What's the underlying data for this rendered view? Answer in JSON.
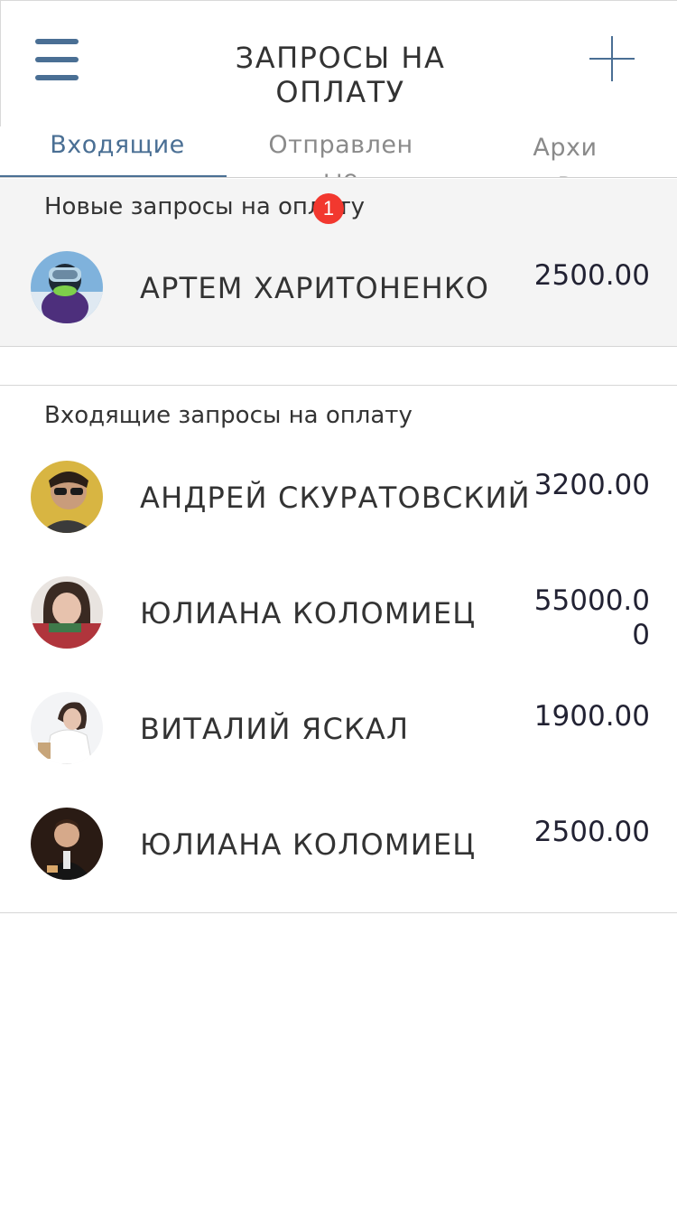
{
  "header": {
    "title": "ЗАПРОСЫ НА ОПЛАТУ",
    "menu_icon": "hamburger-menu-icon",
    "add_icon": "plus-icon"
  },
  "tabs": [
    {
      "label": "Входящие",
      "active": true
    },
    {
      "label": "Отправленые",
      "active": false
    },
    {
      "label": "Архив",
      "active": false
    }
  ],
  "new_requests": {
    "title": "Новые запросы на оплату",
    "badge_count": "1",
    "items": [
      {
        "name": "АРТЕМ ХАРИТОНЕНКО",
        "amount": "2500.00",
        "avatar": "avatar-photo"
      }
    ]
  },
  "incoming_requests": {
    "title": "Входящие запросы на оплату",
    "items": [
      {
        "name": "АНДРЕЙ СКУРАТОВСКИЙ",
        "amount": "3200.00",
        "avatar": "avatar-photo"
      },
      {
        "name": "ЮЛИАНА КОЛОМИЕЦ",
        "amount": "55000.00",
        "avatar": "avatar-photo"
      },
      {
        "name": "ВИТАЛИЙ ЯСКАЛ",
        "amount": "1900.00",
        "avatar": "avatar-photo"
      },
      {
        "name": "ЮЛИАНА КОЛОМИЕЦ",
        "amount": "2500.00",
        "avatar": "avatar-photo"
      }
    ]
  },
  "colors": {
    "accent": "#4a6f94",
    "badge": "#f2382f",
    "section_bg": "#f4f4f4"
  }
}
